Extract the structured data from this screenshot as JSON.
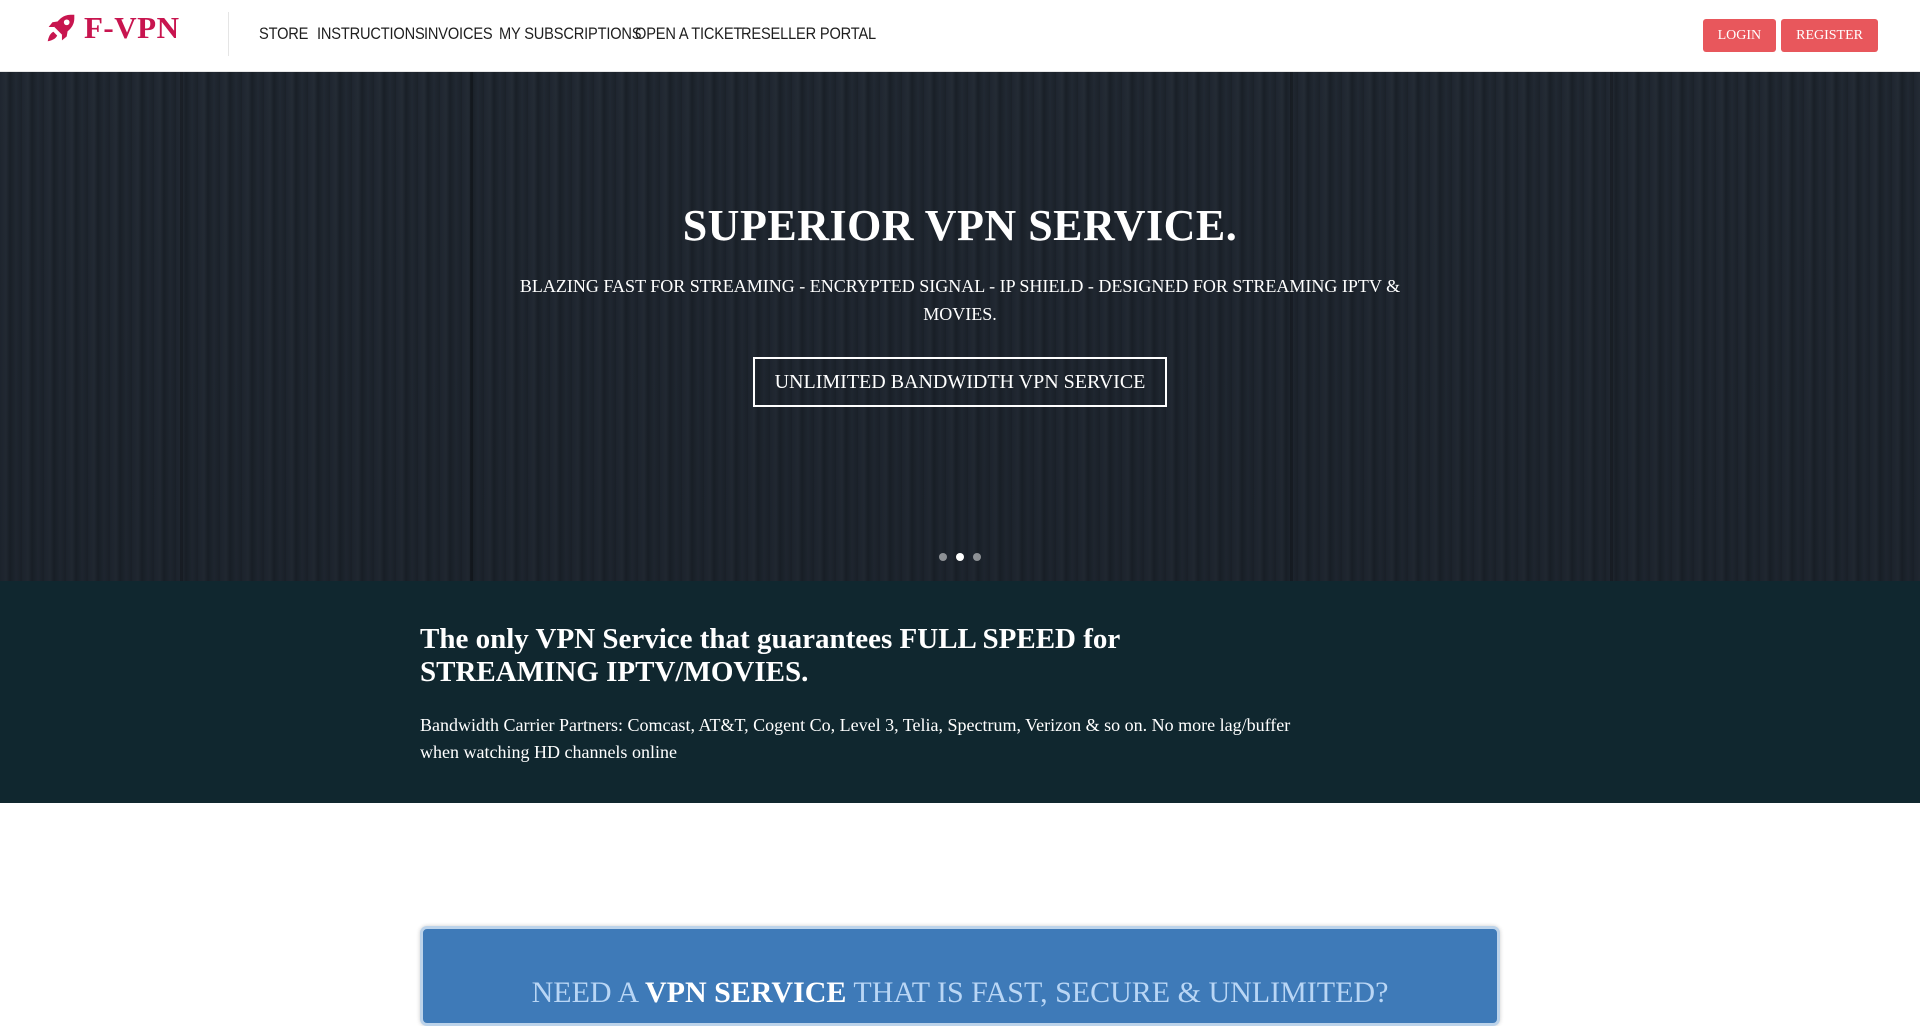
{
  "header": {
    "brand": "F-VPN",
    "nav": [
      "STORE",
      "INSTRUCTIONS",
      "INVOICES",
      "MY SUBSCRIPTIONS",
      "OPEN A TICKET",
      "RESELLER PORTAL"
    ],
    "login_label": "LOGIN",
    "register_label": "REGISTER"
  },
  "hero": {
    "title": "SUPERIOR VPN SERVICE.",
    "subtitle": "BLAZING FAST FOR STREAMING - ENCRYPTED SIGNAL - IP SHIELD - DESIGNED FOR STREAMING IPTV & MOVIES.",
    "cta_label": "UNLIMITED BANDWIDTH VPN SERVICE",
    "slides": 3,
    "active_slide": 2
  },
  "band": {
    "title": "The only VPN Service that guarantees FULL SPEED for STREAMING IPTV/MOVIES.",
    "text": "Bandwidth Carrier Partners: Comcast, AT&T, Cogent Co, Level 3, Telia, Spectrum, Verizon & so on. No more lag/buffer when watching HD channels online"
  },
  "promo": {
    "part1": "NEED A ",
    "part2": "VPN SERVICE",
    "part3": " THAT IS FAST, SECURE & UNLIMITED?"
  },
  "colors": {
    "brand": "#c8154f",
    "auth_button": "#e8575c",
    "band_bg": "#10272f",
    "promo_bg": "#3e7ab8"
  }
}
